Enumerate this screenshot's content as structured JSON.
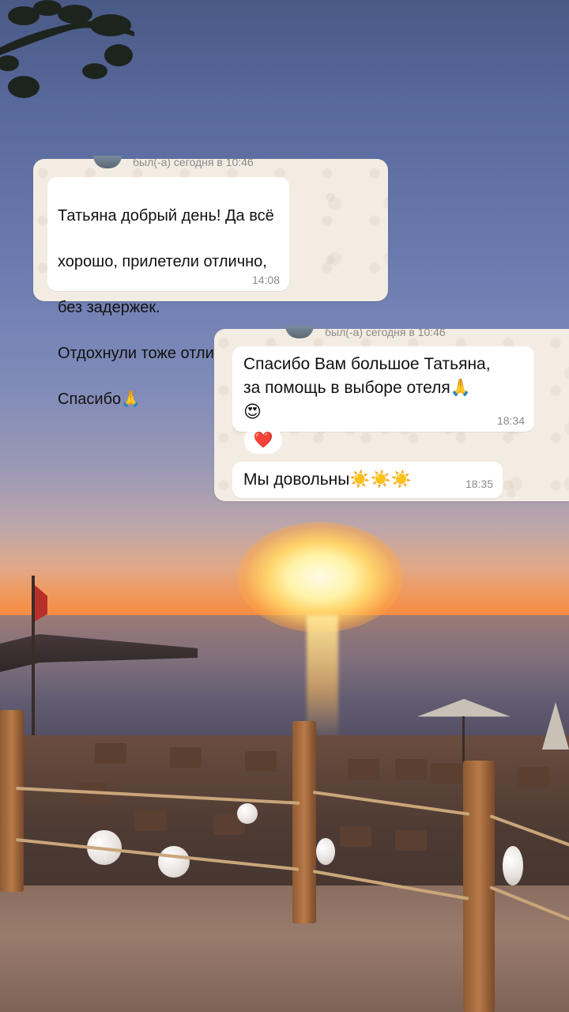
{
  "chat1": {
    "status": "был(-а) сегодня в 10:46",
    "message": {
      "lines": [
        "Татьяна добрый день! Да всё",
        "хорошо, прилетели отлично,",
        "без задержек.",
        "Отдохнули тоже отлично❤️",
        "Спасибо🙏"
      ],
      "time": "14:08"
    }
  },
  "chat2": {
    "status": "был(-а) сегодня в 10:46",
    "message1": {
      "line1": "Спасибо Вам большое Татьяна,",
      "line2": "за помощь в выборе отеля🙏",
      "emoji": "😍",
      "time": "18:34"
    },
    "reaction": "❤️",
    "message2": {
      "text": "Мы довольны☀️☀️☀️",
      "time": "18:35"
    }
  }
}
